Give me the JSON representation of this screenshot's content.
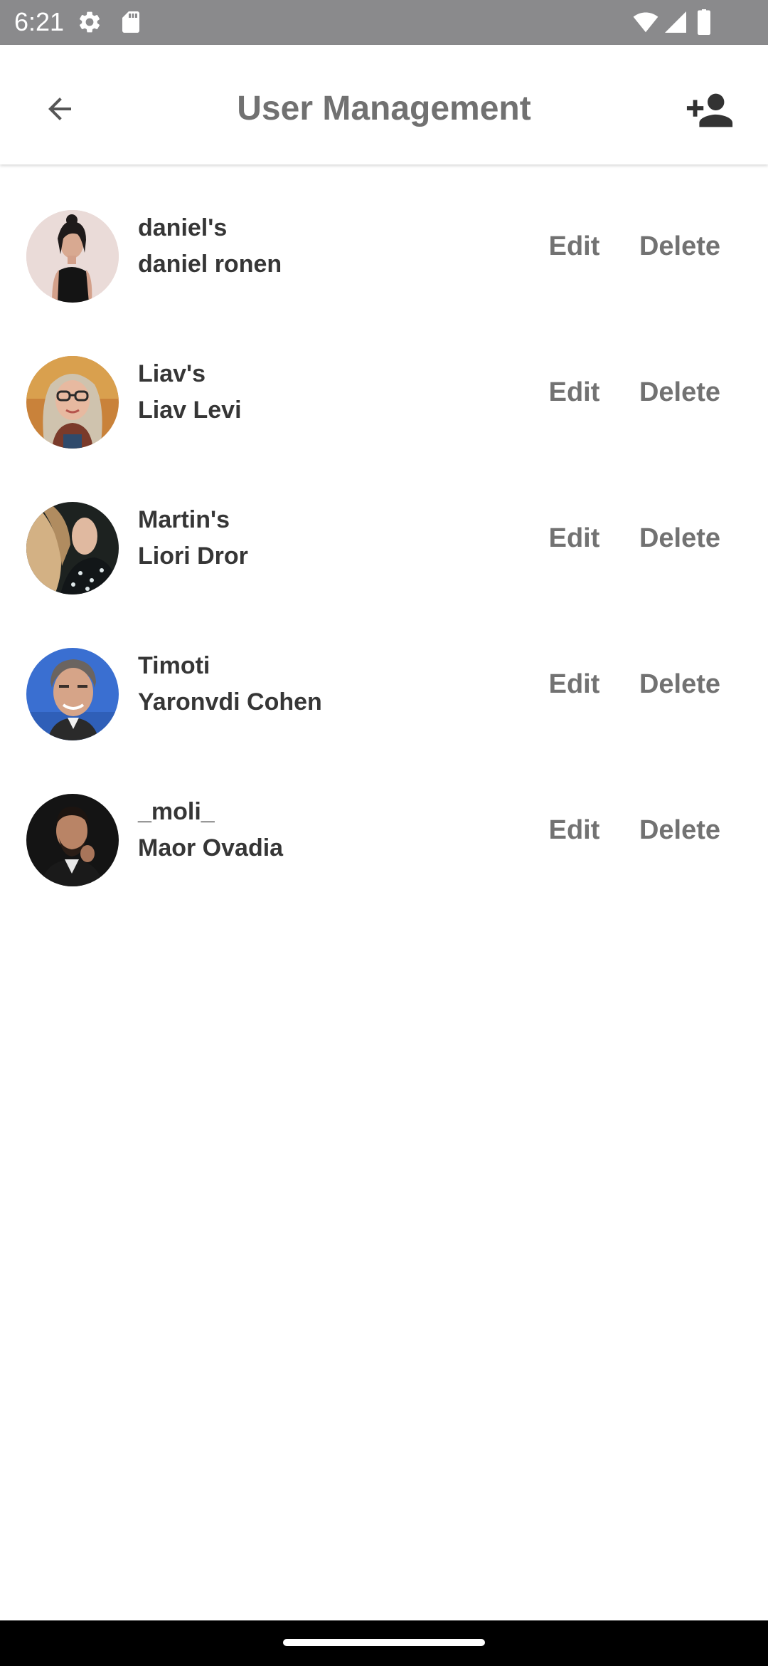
{
  "status_bar": {
    "time": "6:21",
    "left_icons": [
      "settings-gear-icon",
      "sd-card-icon"
    ],
    "right_icons": [
      "wifi-icon",
      "signal-icon",
      "battery-icon"
    ]
  },
  "app_bar": {
    "title": "User Management",
    "back_icon": "arrow-back-icon",
    "action_icon": "person-add-icon"
  },
  "users": [
    {
      "handle": "daniel's",
      "full_name": "daniel ronen",
      "edit_label": "Edit",
      "delete_label": "Delete"
    },
    {
      "handle": "Liav's",
      "full_name": "Liav Levi",
      "edit_label": "Edit",
      "delete_label": "Delete"
    },
    {
      "handle": "Martin's",
      "full_name": "Liori Dror",
      "edit_label": "Edit",
      "delete_label": "Delete"
    },
    {
      "handle": "Timoti",
      "full_name": "Yaronvdi Cohen",
      "edit_label": "Edit",
      "delete_label": "Delete"
    },
    {
      "handle": "_moli_",
      "full_name": "Maor Ovadia",
      "edit_label": "Edit",
      "delete_label": "Delete"
    }
  ],
  "colors": {
    "status_bar": "#8a8a8c",
    "title_text": "#717171",
    "user_text": "#363636",
    "action_text": "#727272",
    "nav_bar": "#000000"
  }
}
